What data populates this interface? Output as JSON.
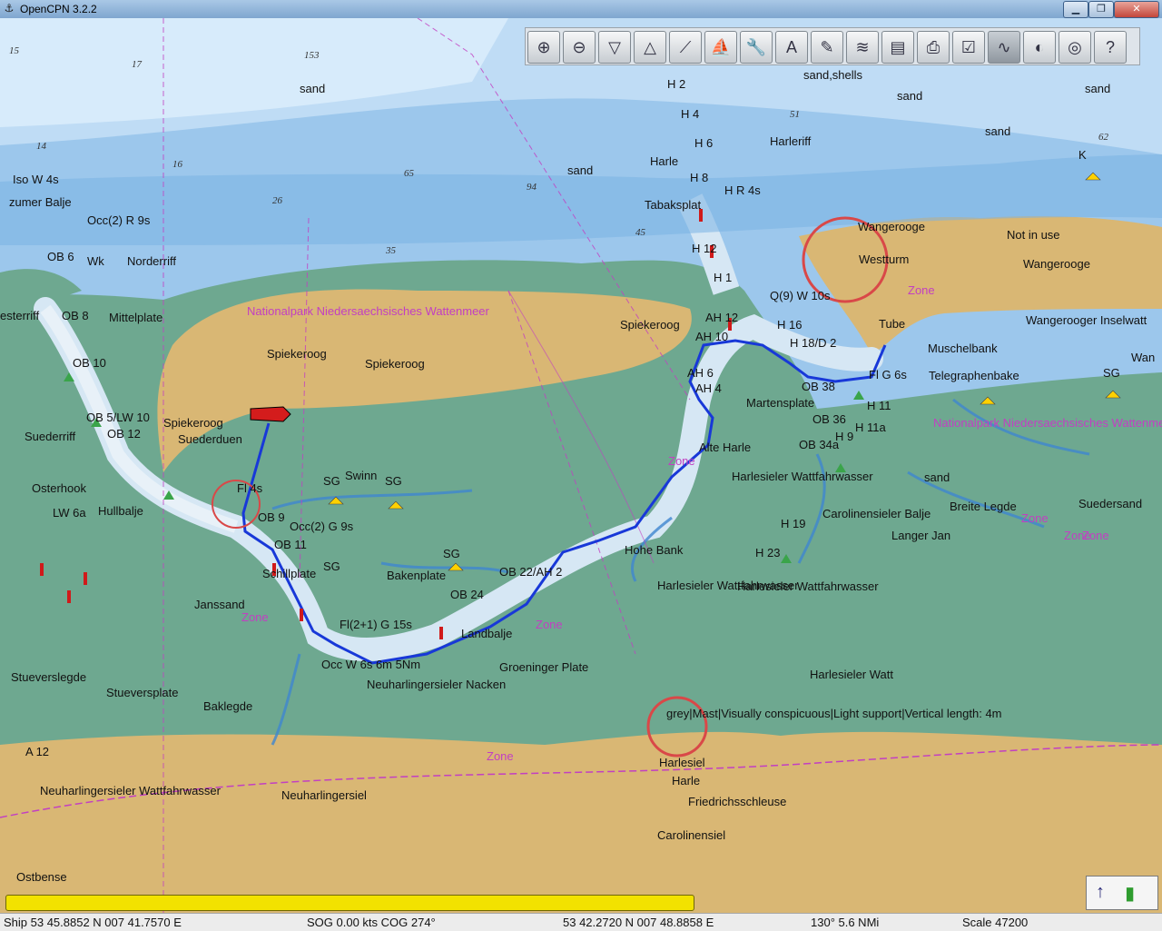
{
  "window": {
    "title": "OpenCPN 3.2.2",
    "icon": "opencpn-app-icon",
    "controls": [
      "minimize-icon",
      "maximize-icon",
      "close-icon"
    ]
  },
  "toolbar": {
    "buttons": [
      {
        "name": "zoom-in",
        "icon": "zoom-in-icon"
      },
      {
        "name": "zoom-out",
        "icon": "zoom-out-icon"
      },
      {
        "name": "scale-in",
        "icon": "scale-in-icon"
      },
      {
        "name": "scale-out",
        "icon": "scale-out-icon"
      },
      {
        "name": "route",
        "icon": "route-icon"
      },
      {
        "name": "follow",
        "icon": "follow-icon"
      },
      {
        "name": "settings",
        "icon": "wrench-icon"
      },
      {
        "name": "text",
        "icon": "text-icon"
      },
      {
        "name": "current",
        "icon": "current-icon"
      },
      {
        "name": "tide",
        "icon": "tide-icon"
      },
      {
        "name": "tides-currents",
        "icon": "tides-icon"
      },
      {
        "name": "print",
        "icon": "print-icon"
      },
      {
        "name": "route-manager",
        "icon": "route-manager-icon"
      },
      {
        "name": "track",
        "icon": "track-icon"
      },
      {
        "name": "color-scheme",
        "icon": "color-scheme-icon"
      },
      {
        "name": "mob",
        "icon": "mob-icon"
      },
      {
        "name": "help",
        "icon": "help-icon"
      }
    ],
    "active_button": "track"
  },
  "chart": {
    "place_labels": [
      "sand",
      "sand,shells",
      "sand",
      "sand",
      "sand",
      "sand",
      "Iso W 4s",
      "zumer Balje",
      "Occ(2) R 9s",
      "OB 6",
      "Wk",
      "Norderriff",
      "esterriff",
      "OB 8",
      "Mittelplate",
      "OB 10",
      "OB 5/LW 10",
      "OB 12",
      "Suederriff",
      "Spiekeroog",
      "Suederduen",
      "Spiekeroog",
      "Spiekeroog",
      "Spiekeroog",
      "Nationalpark Niedersaechsisches Wattenmeer",
      "Osterhook",
      "Hullbalje",
      "LW 6a",
      "Fl 4s",
      "SG",
      "Swinn",
      "SG",
      "Occ(2) G 9s",
      "OB 9",
      "OB 11",
      "Schillplate",
      "SG",
      "Bakenplate",
      "SG",
      "OB 22/AH 2",
      "OB 24",
      "Janssand",
      "Zone",
      "Fl(2+1) G 15s",
      "Landbalje",
      "Occ W 6s 6m 5Nm",
      "Neuharlingersieler Nacken",
      "Groeninger Plate",
      "Stueverslegde",
      "Stueversplate",
      "Baklegde",
      "A 12",
      "Neuharlingersieler Wattfahrwasser",
      "Neuharlingersiel",
      "Ostbense",
      "Hohe Bank",
      "Harlesieler Wattfahrwasser",
      "Harlesieler Watt",
      "grey|Mast|Visually conspicuous|Light support|Vertical length: 4m",
      "Harlesiel",
      "Harle",
      "Friedrichsschleuse",
      "Carolinensiel",
      "Zone",
      "Zone",
      "Zone",
      "H 2",
      "H 4",
      "H 6",
      "Harle",
      "H 8",
      "H R 4s",
      "Tabaksplat",
      "Harleriff",
      "H 12",
      "H 1",
      "AH 12",
      "AH 10",
      "AH 6",
      "AH 4",
      "Alte Harle",
      "Q(9) W 10s",
      "H 16",
      "H 18/D 2",
      "OB 38",
      "Martensplate",
      "OB 36",
      "OB 34a",
      "H 9",
      "H 11",
      "H 11a",
      "Wangerooge",
      "Westturm",
      "Not in use",
      "Wangerooge",
      "Tube",
      "Muschelbank",
      "Telegraphenbake",
      "Fl G 6s",
      "SG",
      "Wangerooger Inselwatt",
      "Wan",
      "Nationalpark Niedersaechsisches Wattenmeer",
      "Zone",
      "Harlesieler Wattfahrwasser",
      "sand",
      "Carolinensieler Balje",
      "Langer Jan",
      "Breite Legde",
      "Suedersand",
      "H 19",
      "H 23",
      "Harlesieler Wattfahrwasser",
      "Zone",
      "Zone",
      "K",
      "Zone"
    ],
    "depth_soundings": [
      "15",
      "17",
      "153",
      "14",
      "16",
      "65",
      "35",
      "45",
      "51",
      "62",
      "94",
      "26"
    ]
  },
  "piano": {
    "fill_fraction": 1.0
  },
  "compass": {
    "icons": [
      "north-arrow-icon",
      "gps-signal-icon"
    ]
  },
  "status": {
    "ship": "Ship 53 45.8852 N   007 41.7570 E",
    "sog_cog": "SOG 0.00 kts   COG 274°",
    "cursor_pos": "53 42.2720 N   007 48.8858 E",
    "bearing_dist": "130°   5.6 NMi",
    "scale": "Scale 47200"
  }
}
